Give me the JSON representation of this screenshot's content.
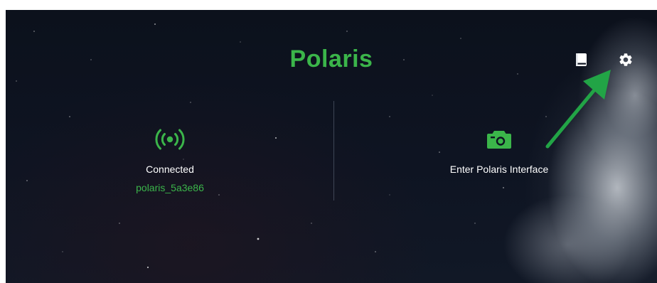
{
  "app": {
    "title": "Polaris"
  },
  "toolbar": {
    "manual_icon": "book-icon",
    "settings_icon": "gear-icon"
  },
  "connection": {
    "icon": "broadcast-icon",
    "status": "Connected",
    "device_name": "polaris_5a3e86"
  },
  "interface": {
    "icon": "camera-icon",
    "label": "Enter Polaris Interface"
  },
  "annotation": {
    "icon": "arrow-icon",
    "color": "#22a446"
  },
  "colors": {
    "accent": "#3bb54a",
    "text": "#ffffff",
    "background": "#0e1422"
  }
}
